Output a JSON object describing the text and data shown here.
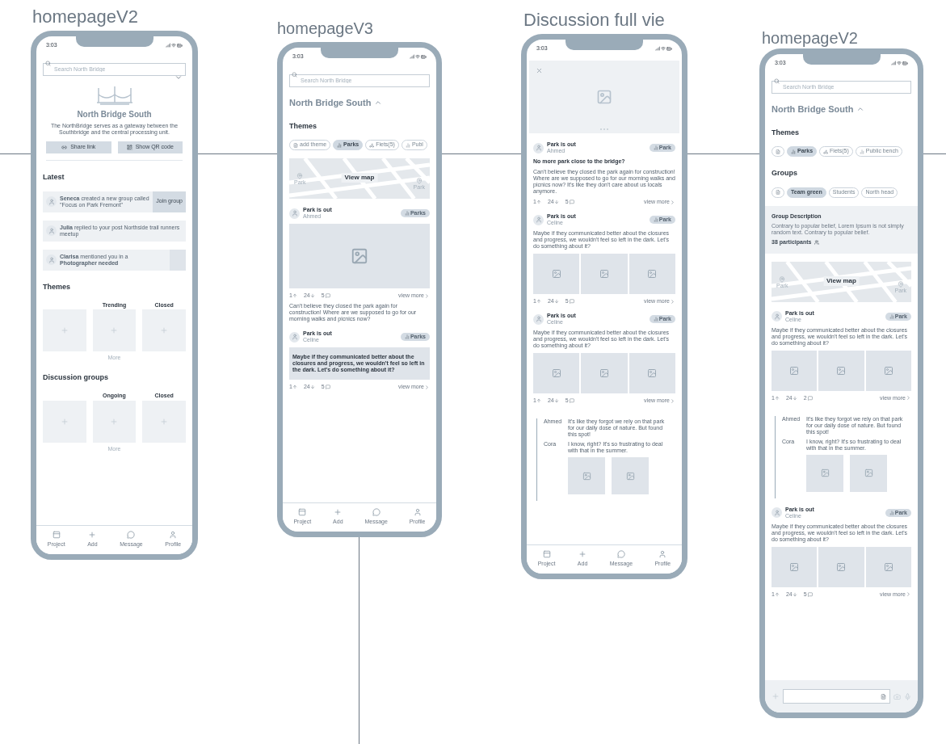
{
  "artboards": [
    {
      "title": "homepageV2",
      "time": "3:03",
      "blocks": [
        {
          "kind": "search",
          "placeholder": "Search North Bridge"
        },
        {
          "kind": "hero",
          "title": "North Bridge South",
          "description": "The NorthBridge serves as a gateway between the Southbridge and the central processing unit.",
          "buttons": [
            "Share link",
            "Show QR code"
          ]
        },
        {
          "kind": "heading",
          "text": "Latest"
        },
        {
          "kind": "activity",
          "text": "**Seneca** created a new group called \"Focus on Park Fremont\"",
          "action": {
            "kind": "button",
            "label": "Join group"
          }
        },
        {
          "kind": "activity",
          "text": "**Julia** replied to your post Northside trail runners meetup"
        },
        {
          "kind": "activity",
          "text": "**Clarisa** mentioned you in a **Photographer needed**",
          "action": {
            "kind": "thumbnail"
          }
        },
        {
          "kind": "heading",
          "text": "Themes"
        },
        {
          "kind": "tiles",
          "tiles": [
            {
              "kind": "add"
            },
            {
              "kind": "add",
              "label": "Trending"
            },
            {
              "kind": "add",
              "label": "Closed"
            }
          ],
          "more": "More"
        },
        {
          "kind": "heading",
          "text": "Discussion groups"
        },
        {
          "kind": "tiles",
          "tiles": [
            {
              "kind": "add"
            },
            {
              "kind": "add",
              "label": "Ongoing"
            },
            {
              "kind": "add",
              "label": "Closed"
            }
          ],
          "more": "More"
        }
      ],
      "footer": {
        "kind": "nav",
        "items": [
          "Project",
          "Add",
          "Message",
          "Profile"
        ]
      }
    },
    {
      "title": "homepageV3",
      "time": "3:03",
      "blocks": [
        {
          "kind": "search",
          "placeholder": "Search North Bridge"
        },
        {
          "kind": "region",
          "title": "North Bridge South",
          "expanded": true
        },
        {
          "kind": "heading",
          "text": "Themes"
        },
        {
          "kind": "chips",
          "items": [
            {
              "kind": "add",
              "label": "add theme",
              "selected": false
            },
            {
              "kind": "tag",
              "label": "Parks",
              "selected": true
            },
            {
              "kind": "group",
              "label": "Fiets(5)",
              "selected": false
            },
            {
              "kind": "tag",
              "label": "Publ",
              "selected": false
            }
          ]
        },
        {
          "kind": "map",
          "label": "View map",
          "pins": [
            "Park",
            "Park"
          ]
        },
        {
          "kind": "post",
          "author": "Park is out",
          "name": "Ahmed",
          "tag": "Parks",
          "parts": [
            {
              "kind": "image"
            },
            {
              "kind": "stats",
              "up": "1",
              "down": "24",
              "comments": "5",
              "more": "view more"
            },
            {
              "kind": "text",
              "text": "Can't believe they closed the park again for construction! Where are we supposed to go for our morning walks and picnics now?",
              "highlighted": false
            }
          ]
        },
        {
          "kind": "post",
          "author": "Park is out",
          "name": "Celine",
          "tag": "Parks",
          "parts": [
            {
              "kind": "text",
              "text": "Maybe if they communicated better about the closures and progress, we wouldn't feel so left in the dark. Let's do something about it?",
              "highlighted": true
            },
            {
              "kind": "stats",
              "up": "1",
              "down": "24",
              "comments": "5",
              "more": "view more"
            }
          ]
        }
      ],
      "footer": {
        "kind": "nav",
        "items": [
          "Project",
          "Add",
          "Message",
          "Profile"
        ]
      }
    },
    {
      "title": "Discussion full vie",
      "time": "3:03",
      "blocks": [
        {
          "kind": "banner"
        },
        {
          "kind": "post",
          "author": "Park is out",
          "name": "Ahmed",
          "tag": "Park",
          "parts": [
            {
              "kind": "title",
              "text": "No more park close to the bridge?"
            },
            {
              "kind": "text",
              "text": "Can't believe they closed the park again for construction! Where are we supposed to go for our morning walks and picnics now? It's like they don't care about us locals anymore.",
              "highlighted": false
            },
            {
              "kind": "stats",
              "up": "1",
              "down": "24",
              "comments": "5",
              "more": "view more"
            }
          ]
        },
        {
          "kind": "post",
          "author": "Park is out",
          "name": "Celine",
          "tag": "Park",
          "parts": [
            {
              "kind": "text",
              "text": "Maybe if they communicated better about the closures and progress, we wouldn't feel so left in the dark. Let's do something about it?",
              "highlighted": false
            },
            {
              "kind": "gallery",
              "images": [
                {
                  "kind": "picture"
                },
                {
                  "kind": "picture"
                },
                {
                  "kind": "picture"
                }
              ]
            },
            {
              "kind": "stats",
              "up": "1",
              "down": "24",
              "comments": "5",
              "more": "view more"
            }
          ]
        },
        {
          "kind": "post",
          "author": "Park is out",
          "name": "Celine",
          "tag": "Park",
          "parts": [
            {
              "kind": "text",
              "text": "Maybe if they communicated better about the closures and progress, we wouldn't feel so left in the dark. Let's do something about it?",
              "highlighted": false
            },
            {
              "kind": "gallery",
              "images": [
                {
                  "kind": "picture"
                },
                {
                  "kind": "picture"
                },
                {
                  "kind": "picture"
                }
              ]
            },
            {
              "kind": "stats",
              "up": "1",
              "down": "24",
              "comments": "5",
              "more": "view more"
            }
          ]
        },
        {
          "kind": "thread",
          "replies": [
            {
              "name": "Ahmed",
              "text": "It's like they forgot we rely on that park for our daily dose of nature. But found this spot!"
            },
            {
              "name": "Cora",
              "text": "I know, right? It's so frustrating to deal with that in the summer."
            }
          ],
          "images": [
            {
              "kind": "picture"
            },
            {
              "kind": "picture"
            }
          ]
        }
      ],
      "footer": {
        "kind": "nav",
        "items": [
          "Project",
          "Add",
          "Message",
          "Profile"
        ]
      }
    },
    {
      "title": "homepageV2",
      "time": "3:03",
      "blocks": [
        {
          "kind": "search",
          "placeholder": "Search North Bridge"
        },
        {
          "kind": "region",
          "title": "North Bridge South",
          "expanded": true
        },
        {
          "kind": "heading",
          "text": "Themes"
        },
        {
          "kind": "chips",
          "items": [
            {
              "kind": "add",
              "selected": false
            },
            {
              "kind": "tag",
              "label": "Parks",
              "selected": true
            },
            {
              "kind": "group",
              "label": "Fiets(5)",
              "selected": false
            },
            {
              "kind": "tag",
              "label": "Public bench",
              "selected": false
            }
          ]
        },
        {
          "kind": "heading",
          "text": "Groups"
        },
        {
          "kind": "chips",
          "items": [
            {
              "kind": "add",
              "selected": false
            },
            {
              "kind": "plain",
              "label": "Team green",
              "selected": true
            },
            {
              "kind": "plain",
              "label": "Students",
              "selected": false
            },
            {
              "kind": "plain",
              "label": "North head",
              "selected": false
            }
          ]
        },
        {
          "kind": "group_info",
          "title": "Group Description",
          "text": "Contrary to popular belief, Lorem Ipsum is not simply random text. Contrary to popular belief.",
          "participants": "38 participants"
        },
        {
          "kind": "map",
          "label": "View map",
          "pins": [
            "Park",
            "Park"
          ]
        },
        {
          "kind": "post",
          "author": "Park is out",
          "name": "Celine",
          "tag": "Park",
          "parts": [
            {
              "kind": "text",
              "text": "Maybe if they communicated better about the closures and progress, we wouldn't feel so left in the dark. Let's do something about it?",
              "highlighted": false
            },
            {
              "kind": "gallery",
              "images": [
                {
                  "kind": "picture"
                },
                {
                  "kind": "picture"
                },
                {
                  "kind": "picture"
                }
              ]
            },
            {
              "kind": "stats",
              "up": "1",
              "down": "24",
              "comments": "2",
              "more": "view more"
            }
          ]
        },
        {
          "kind": "thread",
          "replies": [
            {
              "name": "Ahmed",
              "text": "It's like they forgot we rely on that park for our daily dose of nature. But found this spot!"
            },
            {
              "name": "Cora",
              "text": "I know, right? It's so frustrating to deal with that in the summer."
            }
          ],
          "images": [
            {
              "kind": "picture"
            },
            {
              "kind": "picture"
            }
          ]
        },
        {
          "kind": "post",
          "author": "Park is out",
          "name": "Celine",
          "tag": "Park",
          "parts": [
            {
              "kind": "text",
              "text": "Maybe if they communicated better about the closures and progress, we wouldn't feel so left in the dark. Let's do something about it?",
              "highlighted": false
            },
            {
              "kind": "gallery",
              "images": [
                {
                  "kind": "picture"
                },
                {
                  "kind": "picture"
                },
                {
                  "kind": "picture"
                }
              ]
            },
            {
              "kind": "stats",
              "up": "1",
              "down": "24",
              "comments": "5",
              "more": "view more"
            }
          ]
        }
      ],
      "footer": {
        "kind": "composer"
      }
    }
  ]
}
